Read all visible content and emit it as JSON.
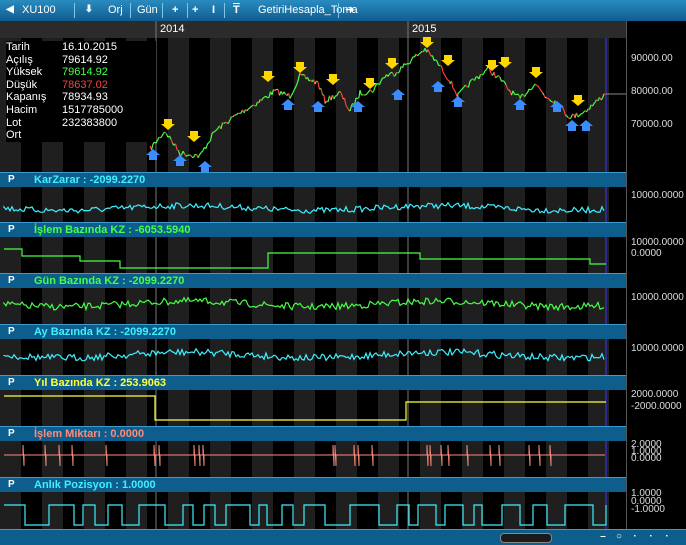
{
  "toolbar": {
    "symbol": "XU100",
    "period_mode": "Orj",
    "period": "Gün",
    "plus_label": "+",
    "bar_label": "I",
    "t_label": "T",
    "formula": "GetiriHesapla_Toma",
    "arrow_label": "➜"
  },
  "years": [
    "2014",
    "2015"
  ],
  "info": {
    "labels": [
      "Tarih",
      "Açılış",
      "Yüksek",
      "Düşük",
      "Kapanış",
      "Hacim",
      "Lot",
      "Ort"
    ],
    "values": [
      "16.10.2015",
      "79614.92",
      "79614.92",
      "78637.02",
      "78934.93",
      "1517785000",
      "232383800",
      ""
    ],
    "colors": [
      "#ffffff",
      "#ffffff",
      "#46ff46",
      "#ff4040",
      "#ffffff",
      "#ffffff",
      "#ffffff",
      "#ffffff"
    ]
  },
  "price_axis": [
    "90000.00",
    "80000.00",
    "70000.00"
  ],
  "panels": [
    {
      "p": "P",
      "title": "KarZarar : -2099.2270",
      "color": "#3ff0ff",
      "axis": [
        "10000.0000"
      ]
    },
    {
      "p": "P",
      "title": "İşlem Bazında KZ : -6053.5940",
      "color": "#46ff46",
      "axis": [
        "10000.0000",
        "0.0000"
      ]
    },
    {
      "p": "P",
      "title": "Gün Bazında KZ : -2099.2270",
      "color": "#46ff46",
      "axis": [
        "10000.0000"
      ]
    },
    {
      "p": "P",
      "title": "Ay Bazında KZ : -2099.2270",
      "color": "#3ff0ff",
      "axis": [
        "10000.0000"
      ]
    },
    {
      "p": "P",
      "title": "Yıl Bazında KZ : 253.9063",
      "color": "#ffff3c",
      "axis": [
        "2000.0000",
        "-2000.0000"
      ]
    },
    {
      "p": "P",
      "title": "İşlem Miktarı : 0.0000",
      "color": "#ff8a7a",
      "axis": [
        "2.0000",
        "1.0000",
        "0.0000"
      ]
    },
    {
      "p": "P",
      "title": "Anlık Pozisyon : 1.0000",
      "color": "#3ff0ff",
      "axis": [
        "1.0000",
        "0.0000",
        "-1.0000"
      ]
    }
  ],
  "colors": {
    "up": "#46ff46",
    "down": "#ff4040",
    "buy_arrow": "#3a8cff",
    "sell_arrow": "#ffd700",
    "panel_bar": "#0d5e8c"
  }
}
